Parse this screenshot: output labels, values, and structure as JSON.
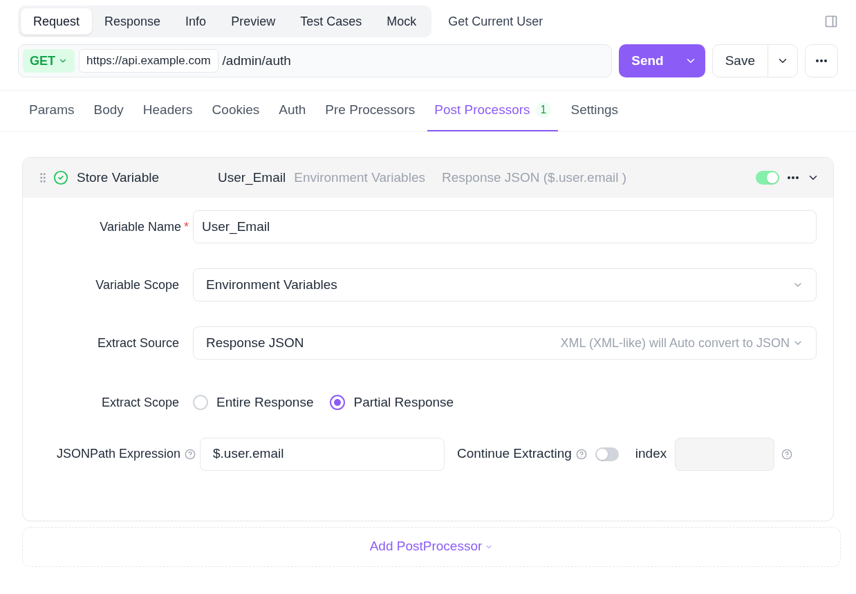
{
  "top_tabs": [
    {
      "label": "Request",
      "selected": true
    },
    {
      "label": "Response",
      "selected": false
    },
    {
      "label": "Info",
      "selected": false
    },
    {
      "label": "Preview",
      "selected": false
    },
    {
      "label": "Test Cases",
      "selected": false
    },
    {
      "label": "Mock",
      "selected": false
    }
  ],
  "endpoint_title": "Get Current User",
  "url_bar": {
    "method": "GET",
    "base_url": "https://api.example.com",
    "path": "/admin/auth",
    "send": "Send",
    "save": "Save"
  },
  "sub_tabs": [
    {
      "label": "Params",
      "selected": false
    },
    {
      "label": "Body",
      "selected": false
    },
    {
      "label": "Headers",
      "selected": false
    },
    {
      "label": "Cookies",
      "selected": false
    },
    {
      "label": "Auth",
      "selected": false
    },
    {
      "label": "Pre Processors",
      "selected": false
    },
    {
      "label": "Post Processors",
      "selected": true,
      "count": "1"
    },
    {
      "label": "Settings",
      "selected": false
    }
  ],
  "processor": {
    "type": "Store Variable",
    "checked": true,
    "variable": "User_Email",
    "scope": "Environment Variables",
    "source": "Response JSON ($.user.email )",
    "on": true,
    "expanded": true,
    "fields": [
      {
        "kind": "input",
        "label": "Variable Name",
        "required": "*",
        "value": "User_Email"
      },
      {
        "kind": "select",
        "label": "Variable Scope",
        "value": "Environment Variables"
      },
      {
        "kind": "select",
        "label": "Extract Source",
        "value": "Response JSON",
        "hint": "XML (XML-like) will Auto convert to JSON"
      },
      {
        "kind": "radio",
        "label": "Extract Scope",
        "options": [
          {
            "label": "Entire Response",
            "selected": false
          },
          {
            "label": "Partial Response",
            "selected": true
          }
        ]
      },
      {
        "kind": "jsonpath",
        "label": "JSONPath Expression",
        "value": "$.user.email",
        "continue_label": "Continue Extracting",
        "continue_on": false,
        "index_label": "index"
      }
    ]
  },
  "add_button": "Add PostProcessor"
}
